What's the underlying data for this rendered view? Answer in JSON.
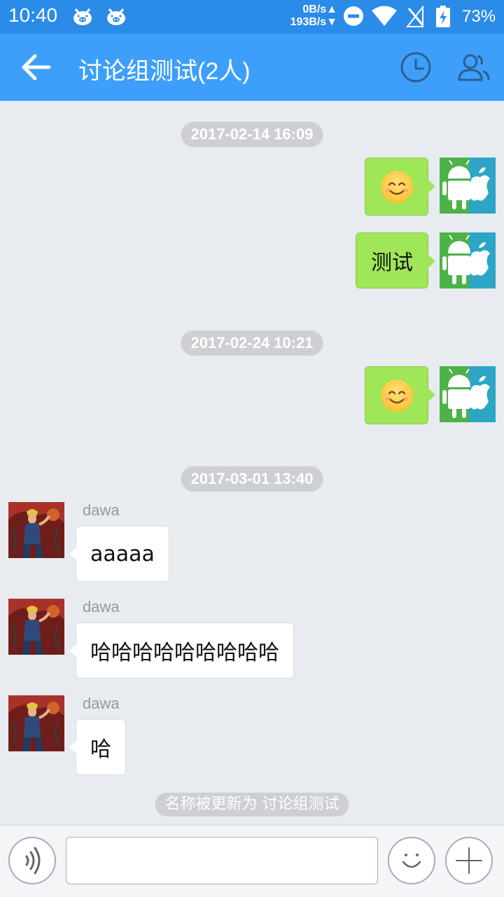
{
  "status_bar": {
    "time": "10:40",
    "speed_up": "0B/s",
    "speed_down": "193B/s",
    "battery": "73%"
  },
  "header": {
    "title": "讨论组测试(2人)"
  },
  "chat": {
    "timestamps": [
      "2017-02-14 16:09",
      "2017-02-24 10:21",
      "2017-03-01 13:40"
    ],
    "my_messages": [
      {
        "type": "emoji",
        "text": ""
      },
      {
        "type": "text",
        "text": "测试"
      },
      {
        "type": "emoji",
        "text": ""
      }
    ],
    "other_messages": [
      {
        "sender": "dawa",
        "text": "aaaaa"
      },
      {
        "sender": "dawa",
        "text": "哈哈哈哈哈哈哈哈哈"
      },
      {
        "sender": "dawa",
        "text": "哈"
      }
    ],
    "system_notice": "名称被更新为 讨论组测试"
  },
  "input": {
    "placeholder": ""
  },
  "colors": {
    "status_bar": "#2B8BE8",
    "header": "#3D9FFA",
    "my_bubble": "#9FE658",
    "background": "#E8EBF0"
  }
}
